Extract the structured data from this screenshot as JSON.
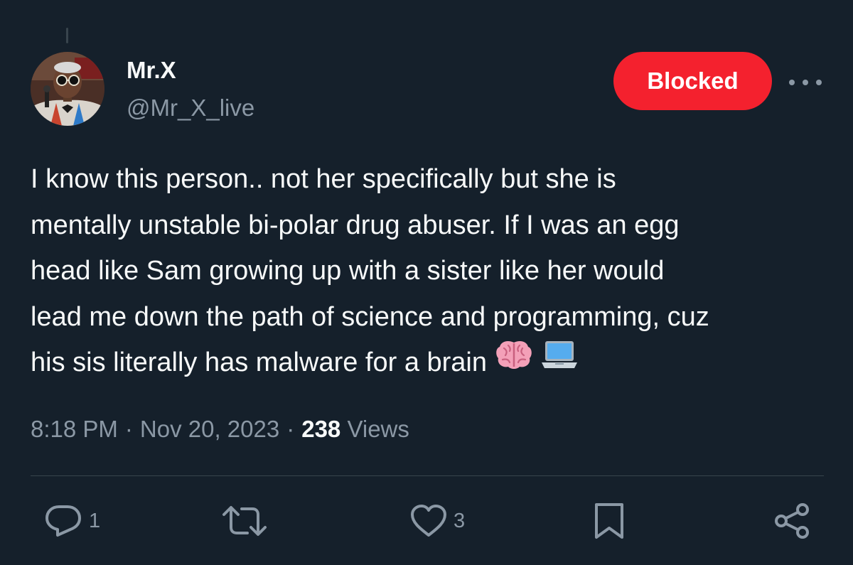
{
  "tweet": {
    "author": {
      "display_name": "Mr.X",
      "handle": "@Mr_X_live",
      "avatar_icon": "avatar"
    },
    "follow_button_label": "Blocked",
    "more_icon": "more-horizontal-icon",
    "text_lines": [
      "I know this person.. not her specifically but she is",
      "mentally unstable bi-polar drug abuser. If I was an egg",
      "head like Sam growing up with a sister like her would",
      "lead me down the path of science and programming, cuz",
      "his sis literally has malware for a brain"
    ],
    "emojis": [
      "brain-emoji",
      "laptop-emoji"
    ],
    "time": "8:18 PM",
    "separator": "·",
    "date": "Nov 20, 2023",
    "views_count": "238",
    "views_label": "Views"
  },
  "actions": {
    "reply_count": "1",
    "retweet_count": "",
    "like_count": "3"
  },
  "colors": {
    "background": "#15202b",
    "text_primary": "#f7f9f9",
    "text_secondary": "#8b98a5",
    "blocked_red": "#f4212e",
    "divider": "#38444d"
  }
}
